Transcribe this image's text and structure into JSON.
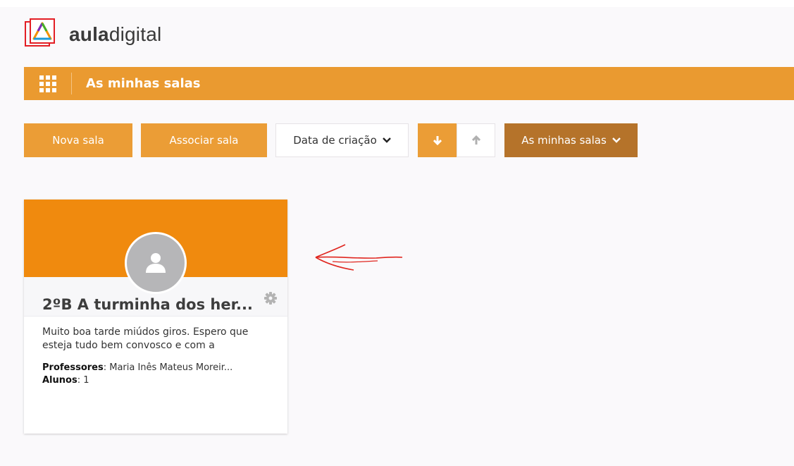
{
  "brand": {
    "name_bold": "aula",
    "name_regular": "digital"
  },
  "topbar": {
    "title": "As minhas salas",
    "apps_icon": "grid-icon"
  },
  "toolbar": {
    "new_room": "Nova sala",
    "associate_room": "Associar sala",
    "sort_by": "Data de criação",
    "sort_desc_icon": "arrow-down-icon",
    "sort_asc_icon": "arrow-up-icon",
    "rooms_filter": "As minhas salas"
  },
  "room_card": {
    "title": "2ºB A turminha dos her...",
    "description": "Muito boa tarde miúdos giros. Espero que esteja tudo bem convosco e com a",
    "teachers_label": "Professores",
    "teachers_value": ": Maria Inês Mateus Moreir...",
    "students_label": "Alunos",
    "students_value": ": 1"
  },
  "colors": {
    "topbar": "#ea9a30",
    "button_orange": "#eb9d36",
    "button_dark": "#b5732a",
    "card_banner": "#f08a0e",
    "annotation": "#e0261f"
  }
}
